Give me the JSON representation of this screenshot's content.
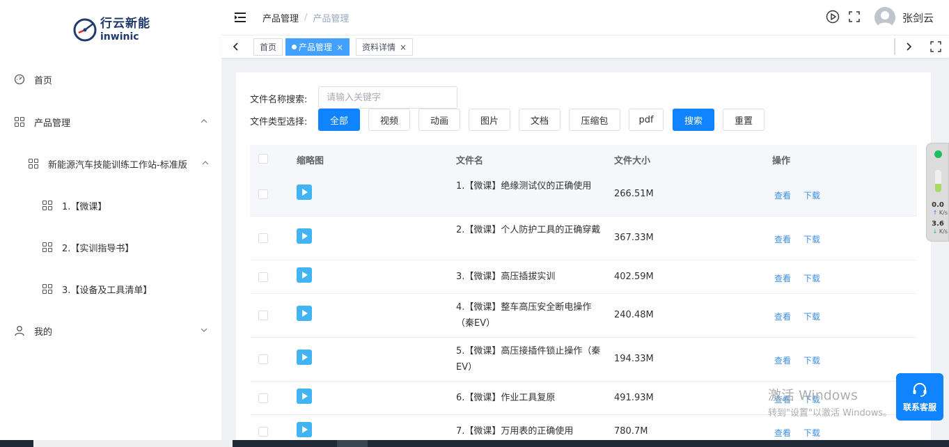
{
  "logo": {
    "cn": "行云新能",
    "en": "inwinic"
  },
  "sidebar": {
    "items": [
      {
        "label": "首页"
      },
      {
        "label": "产品管理"
      },
      {
        "label": "新能源汽车技能训练工作站-标准版"
      },
      {
        "label": "1.【微课】"
      },
      {
        "label": "2.【实训指导书】"
      },
      {
        "label": "3.【设备及工具清单】"
      },
      {
        "label": "我的"
      }
    ]
  },
  "header": {
    "breadcrumb": [
      "产品管理",
      "产品管理"
    ],
    "breadcrumb_sep": "/",
    "username": "张剑云"
  },
  "tags": [
    {
      "label": "首页"
    },
    {
      "label": "产品管理",
      "close": "×"
    },
    {
      "label": "资料详情",
      "close": "×"
    }
  ],
  "filters": {
    "name_label": "文件名称搜索:",
    "name_placeholder": "请输入关键字",
    "type_label": "文件类型选择:",
    "types": [
      "全部",
      "视频",
      "动画",
      "图片",
      "文档",
      "压缩包",
      "pdf"
    ],
    "search_btn": "搜索",
    "reset_btn": "重置"
  },
  "table": {
    "headers": [
      "缩略图",
      "文件名",
      "文件大小",
      "操作"
    ],
    "view_label": "查看",
    "download_label": "下载",
    "rows": [
      {
        "name": "1.【微课】绝缘测试仪的正确使用",
        "size": "266.51M"
      },
      {
        "name": "2.【微课】个人防护工具的正确穿戴",
        "size": "367.33M"
      },
      {
        "name": "3.【微课】高压插拔实训",
        "size": "402.59M"
      },
      {
        "name": "4.【微课】整车高压安全断电操作（秦EV）",
        "size": "240.48M"
      },
      {
        "name": "5.【微课】高压接插件锁止操作（秦EV）",
        "size": "194.33M"
      },
      {
        "name": "6.【微课】作业工具复原",
        "size": "491.93M"
      },
      {
        "name": "7.【微课】万用表的正确使用",
        "size": "780.7M"
      }
    ]
  },
  "net": {
    "up": "0.0",
    "down": "3.6",
    "unit": "K/s"
  },
  "kefu": {
    "label": "联系客服"
  },
  "watermark": {
    "line1": "激活 Windows",
    "line2": "转到\"设置\"以激活 Windows。"
  },
  "colors": {
    "primary": "#1084ff",
    "tag_active": "#42a0ff",
    "link": "#3a8ee6"
  }
}
